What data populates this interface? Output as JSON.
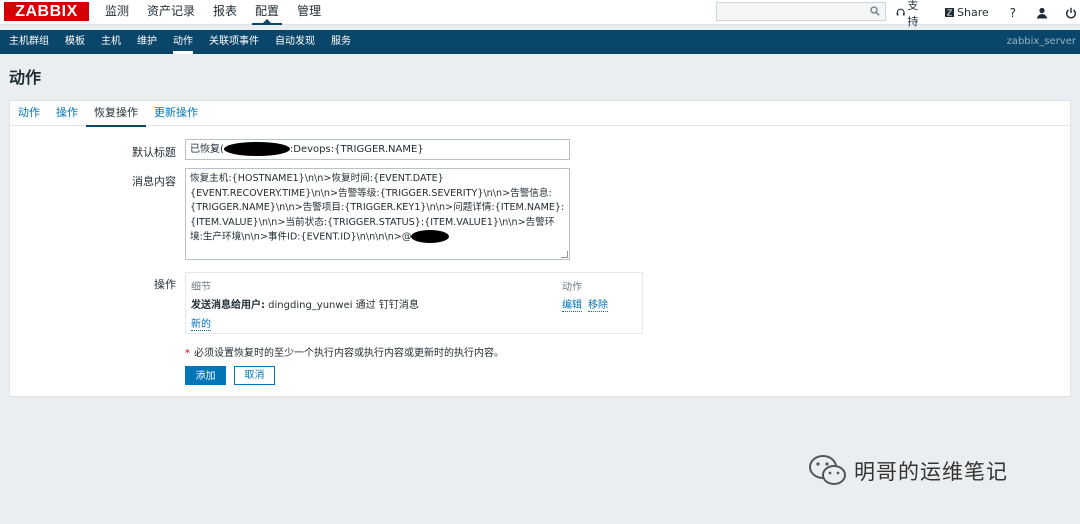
{
  "logo": "ZABBIX",
  "main_menu": [
    {
      "label": "监测",
      "active": false
    },
    {
      "label": "资产记录",
      "active": false
    },
    {
      "label": "报表",
      "active": false
    },
    {
      "label": "配置",
      "active": true
    },
    {
      "label": "管理",
      "active": false
    }
  ],
  "top_links": {
    "support": "支持",
    "share": "Share",
    "help": "?"
  },
  "sub_menu": [
    {
      "label": "主机群组",
      "active": false
    },
    {
      "label": "模板",
      "active": false
    },
    {
      "label": "主机",
      "active": false
    },
    {
      "label": "维护",
      "active": false
    },
    {
      "label": "动作",
      "active": true
    },
    {
      "label": "关联项事件",
      "active": false
    },
    {
      "label": "自动发现",
      "active": false
    },
    {
      "label": "服务",
      "active": false
    }
  ],
  "server_name": "zabbix_server",
  "page_title": "动作",
  "tabs": [
    {
      "label": "动作",
      "active": false
    },
    {
      "label": "操作",
      "active": false
    },
    {
      "label": "恢复操作",
      "active": true
    },
    {
      "label": "更新操作",
      "active": false
    }
  ],
  "form": {
    "default_subject_label": "默认标题",
    "default_subject_prefix": "已恢复(",
    "default_subject_suffix": ":Devops:{TRIGGER.NAME}",
    "message_label": "消息内容",
    "message_value": "恢复主机:{HOSTNAME1}\\n\\n>恢复时间:{EVENT.DATE}\n{EVENT.RECOVERY.TIME}\\n\\n>告警等级:{TRIGGER.SEVERITY}\\n\\n>告警信息:\n{TRIGGER.NAME}\\n\\n>告警项目:{TRIGGER.KEY1}\\n\\n>问题详情:{ITEM.NAME}:\n{ITEM.VALUE}\\n\\n>当前状态:{TRIGGER.STATUS}:{ITEM.VALUE1}\\n\\n>告警环\n境:生产环境\\n\\n>事件ID:{EVENT.ID}\\n\\n\\n\\n>@",
    "operations_label": "操作",
    "operations": {
      "col_detail": "细节",
      "col_action": "动作",
      "row_detail_bold": "发送消息给用户:",
      "row_detail_rest": " dingding_yunwei 通过 钉钉消息",
      "edit": "编辑",
      "remove": "移除",
      "new": "新的"
    },
    "note_star": "*",
    "note": "必须设置恢复时的至少一个执行内容或执行内容或更新时的执行内容。",
    "add_button": "添加",
    "cancel_button": "取消"
  },
  "watermark": "明哥的运维笔记",
  "colors": {
    "brand_red": "#d40000",
    "nav_blue": "#0a466a",
    "link_blue": "#0275b8"
  }
}
